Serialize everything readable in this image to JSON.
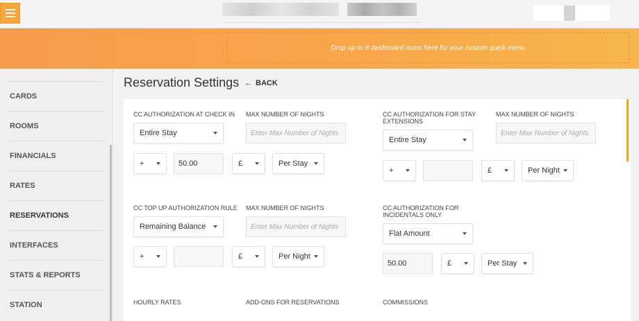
{
  "quick_menu_hint": "Drop up to 8 dashboard icons here for your custom quick menu",
  "sidebar": {
    "items": [
      {
        "label": "CARDS"
      },
      {
        "label": "ROOMS"
      },
      {
        "label": "FINANCIALS"
      },
      {
        "label": "RATES"
      },
      {
        "label": "RESERVATIONS"
      },
      {
        "label": "INTERFACES"
      },
      {
        "label": "STATS & REPORTS"
      },
      {
        "label": "STATION"
      }
    ]
  },
  "page": {
    "title": "Reservation Settings",
    "back_label": "BACK"
  },
  "section1": {
    "label": "CC AUTHORIZATION AT CHECK IN",
    "mode": "Entire Stay",
    "max_nights_label": "MAX NUMBER OF NIGHTS",
    "max_nights_placeholder": "Enter Max Number of Nights",
    "sign": "+",
    "amount": "50.00",
    "currency": "£",
    "unit": "Per Stay"
  },
  "section2": {
    "label": "CC AUTHORIZATION FOR STAY EXTENSIONS",
    "mode": "Entire Stay",
    "max_nights_label": "MAX NUMBER OF NIGHTS",
    "max_nights_placeholder": "Enter Max Number of Nights",
    "sign": "+",
    "amount": "",
    "currency": "£",
    "unit": "Per Night"
  },
  "section3": {
    "label": "CC TOP UP AUTHORIZATION RULE",
    "mode": "Remaining Balance",
    "max_nights_label": "MAX NUMBER OF NIGHTS",
    "max_nights_placeholder": "Enter Max Number of Nights",
    "sign": "+",
    "amount": "",
    "currency": "£",
    "unit": "Per Night"
  },
  "section4": {
    "label": "CC AUTHORIZATION FOR INCIDENTALS ONLY",
    "mode": "Flat Amount",
    "amount": "50.00",
    "currency": "£",
    "unit": "Per Stay"
  },
  "footer_labels": {
    "hourly": "HOURLY RATES",
    "addons": "ADD-ONS FOR RESERVATIONS",
    "commissions": "COMMISSIONS"
  }
}
